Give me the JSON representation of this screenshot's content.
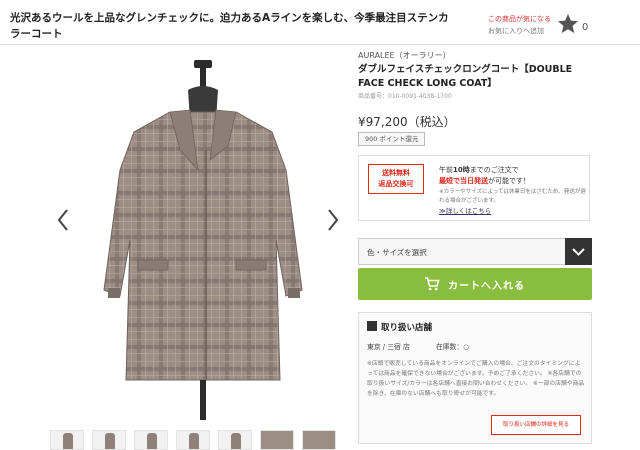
{
  "header": {
    "headline": "光沢あるウールを上品なグレンチェックに。迫力あるAラインを楽しむ、今季最注目ステンカラーコート",
    "favorite_line1": "この商品が気になる",
    "favorite_line2": "お気に入りへ追加",
    "favorite_count": "0"
  },
  "product": {
    "brand": "AURALEE（オーラリー）",
    "title": "ダブルフェイスチェックロングコート【DOUBLE FACE CHECK LONG COAT】",
    "product_number": "商品番号：010-0091-4038-1700",
    "price": "¥97,200（税込）",
    "points": "900 ポイント還元"
  },
  "shipping": {
    "badge_line1": "送料無料",
    "badge_line2": "返品交換可",
    "text_pre": "午前",
    "text_bold_time": "10時",
    "text_mid": "までのご注文で",
    "text_red": "最短で当日発送",
    "text_post": "が可能です！",
    "note": "※カラーやサイズによっては休業日をはさむため、発送が遅れる場合がございます。",
    "link": "≫詳しくはこちら"
  },
  "selector": {
    "label": "色・サイズを選択"
  },
  "cart": {
    "label": "カートへ入れる"
  },
  "stores": {
    "heading": "取り扱い店舗",
    "store_name": "東京 / 三宿 店",
    "stock_label": "在庫数：○",
    "note": "※店頭で販売している商品をオンラインでご購入の場合、ご注文のタイミングによっては商品を確保できない場合がございます。予めご了承ください。 ※各店舗での取り扱いサイズ/カラーは各店舗へ直接お問い合わせください。 ※一部の店舗や商品を除き、在庫のない店舗へも取り寄せが可能です。",
    "link": "取り扱い店舗の詳細を見る"
  },
  "colors": {
    "accent_red": "#e1271b",
    "cart_green": "#88bd3f",
    "coat_base": "#9c8d85"
  }
}
